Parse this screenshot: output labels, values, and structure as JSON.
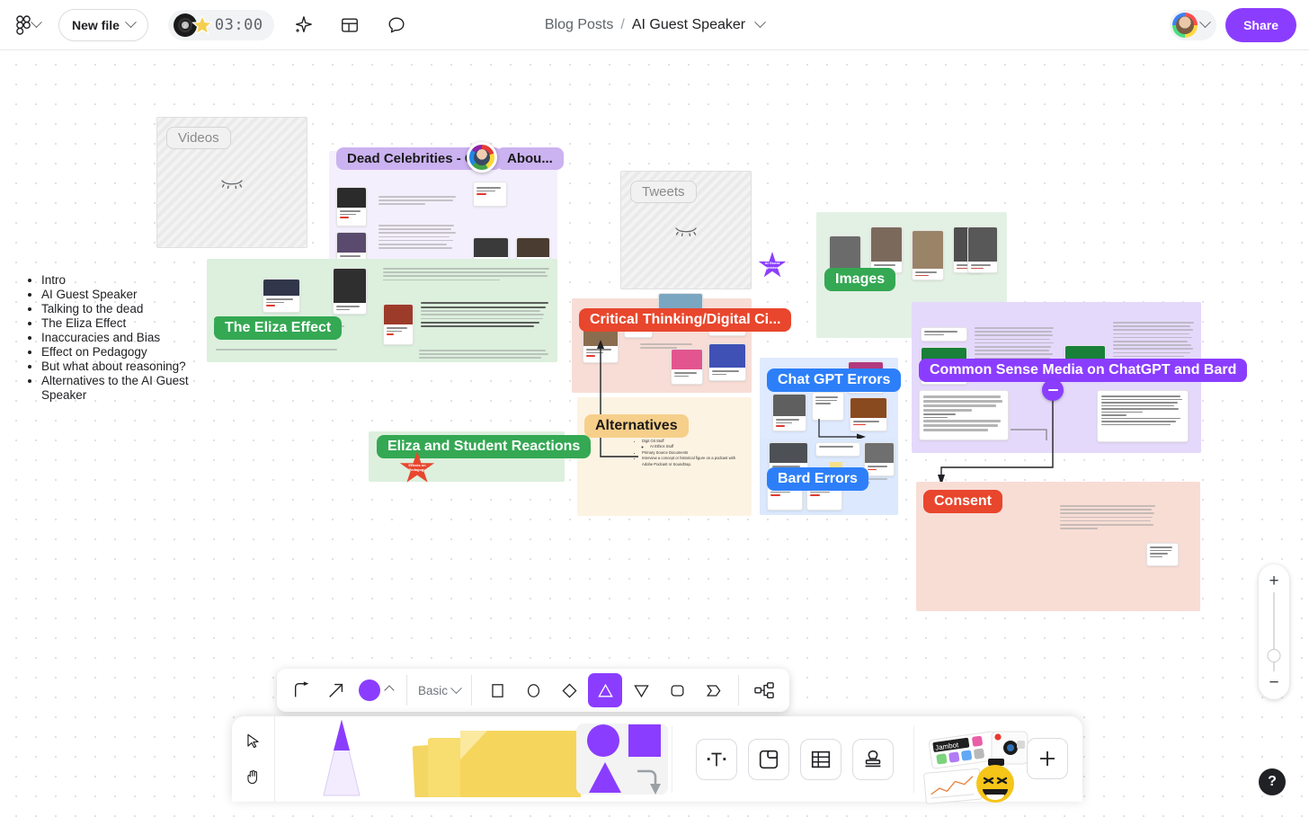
{
  "topbar": {
    "app_menu_icon": "figjam-logo-icon",
    "new_file_label": "New file",
    "timer_value": "03:00",
    "music_icon": "vinyl-record-icon",
    "timer_star_icon": "star-icon",
    "magic_icon": "sparkle-icon",
    "layout_icon": "layout-panel-icon",
    "comment_icon": "comment-bubble-icon",
    "breadcrumb_parent": "Blog Posts",
    "breadcrumb_separator": "/",
    "breadcrumb_title": "AI Guest Speaker",
    "title_chevron_icon": "chevron-down-icon",
    "avatar_icon": "user-avatar",
    "share_label": "Share",
    "accent_color": "#8b3dff"
  },
  "outline": {
    "items": [
      "Intro",
      "AI Guest Speaker",
      "Talking to the dead",
      "The Eliza Effect",
      "Inaccuracies and Bias",
      "Effect on Pedagogy",
      "But what about reasoning?",
      "Alternatives to the AI Guest Speaker"
    ]
  },
  "canvas": {
    "sections": [
      {
        "name": "videos",
        "label": "Videos",
        "state": "hidden",
        "color": "#f1f1f1"
      },
      {
        "name": "dead-celebrities",
        "label": "Dead Celebrities - Con",
        "label_right": "Abou...",
        "state": "visible",
        "color": "#cbb2f0",
        "body": "#f3eefd"
      },
      {
        "name": "eliza-effect",
        "label": "The Eliza Effect",
        "state": "visible",
        "color": "#34a853",
        "body": "#dcf0dd"
      },
      {
        "name": "eliza-reactions",
        "label": "Eliza and Student Reactions",
        "state": "visible",
        "color": "#34a853",
        "body": "#dcf0dd"
      },
      {
        "name": "tweets",
        "label": "Tweets",
        "state": "hidden",
        "color": "#f1f1f1"
      },
      {
        "name": "critical-thinking",
        "label": "Critical Thinking/Digital Ci...",
        "state": "visible",
        "color": "#e8462d",
        "body": "#f7ddd6"
      },
      {
        "name": "alternatives",
        "label": "Alternatives",
        "state": "visible",
        "color": "#f6cf8a",
        "body": "#fdf3e3"
      },
      {
        "name": "images",
        "label": "Images",
        "state": "visible",
        "color": "#34a853",
        "body": "#e3f1e4"
      },
      {
        "name": "chatgpt-errors",
        "label": "Chat GPT Errors",
        "state": "visible",
        "color": "#2d7ff9",
        "body": "#dfeaff"
      },
      {
        "name": "bard-errors",
        "label": "Bard Errors",
        "state": "visible",
        "color": "#2d7ff9",
        "body": "#dbe8fd"
      },
      {
        "name": "common-sense-media",
        "label": "Common Sense Media on ChatGPT and Bard",
        "state": "visible",
        "color": "#8b3dff",
        "body": "#e5d9fb"
      },
      {
        "name": "consent",
        "label": "Consent",
        "state": "visible",
        "color": "#e8462d",
        "body": "#f8ddd5"
      }
    ],
    "stickers": [
      {
        "name": "purple-star-sticker",
        "text": "AI Guest Speakers",
        "color": "#8b3dff"
      },
      {
        "name": "red-star-sticker",
        "text": "Effects on Pedagogy",
        "color": "#e8462d"
      }
    ],
    "alternatives_list": [
      "Digit Oit Stuff",
      "AI Ethics Stuff",
      "Primary Source Documents",
      "Interview a concept or historical figure on a podcast with Adobe Podcast or Soundtrap."
    ],
    "hidden_section_icon": "closed-eye-icon"
  },
  "shape_toolbar": {
    "tools": [
      {
        "name": "elbow-connector-tool",
        "icon": "elbow-arrow-icon"
      },
      {
        "name": "straight-arrow-tool",
        "icon": "arrow-up-right-icon"
      }
    ],
    "color_swatch": "#8b3dff",
    "color_chevron_icon": "chevron-up-icon",
    "style_label": "Basic",
    "style_chevron_icon": "chevron-down-icon",
    "shapes": [
      {
        "name": "shape-square",
        "icon": "square-icon",
        "selected": false
      },
      {
        "name": "shape-circle",
        "icon": "circle-icon",
        "selected": false
      },
      {
        "name": "shape-diamond",
        "icon": "diamond-icon",
        "selected": false
      },
      {
        "name": "shape-triangle",
        "icon": "triangle-icon",
        "selected": true
      },
      {
        "name": "shape-triangle-down",
        "icon": "triangle-down-icon",
        "selected": false
      },
      {
        "name": "shape-rounded-rect",
        "icon": "rounded-rect-icon",
        "selected": false
      },
      {
        "name": "shape-pentagon-arrow",
        "icon": "pentagon-arrow-icon",
        "selected": false
      }
    ],
    "diagram_tool": {
      "name": "diagram-tool",
      "icon": "org-chart-icon"
    }
  },
  "main_toolbar": {
    "cursor_tool_icon": "cursor-arrow-icon",
    "hand_tool_icon": "hand-icon",
    "marker_tool": {
      "name": "marker-tool",
      "icon": "marker-pen-icon"
    },
    "sticky_tool": {
      "name": "sticky-note-tool",
      "icon": "sticky-notes-icon"
    },
    "shapes_tool": {
      "name": "shapes-tool",
      "icon": "shapes-icon",
      "active": true
    },
    "text_tool": {
      "name": "text-tool",
      "icon": "text-t-icon"
    },
    "frame_tool": {
      "name": "frame-tool",
      "icon": "frame-icon"
    },
    "table_tool": {
      "name": "table-tool",
      "icon": "table-icon"
    },
    "stamp_tool": {
      "name": "stamp-tool",
      "icon": "stamp-icon"
    },
    "widgets": {
      "name": "widgets-tool",
      "jambot_label": "Jambot",
      "icons": [
        "jambot-widget",
        "camera-icon",
        "emoji-icon",
        "chart-widget"
      ]
    },
    "add_button": {
      "name": "add-more-button",
      "icon": "plus-icon"
    }
  },
  "zoom_control": {
    "zoom_in_icon": "plus-icon",
    "zoom_out_icon": "minus-icon",
    "slider_name": "zoom-slider"
  },
  "help_button": {
    "name": "help-button",
    "label": "?"
  }
}
